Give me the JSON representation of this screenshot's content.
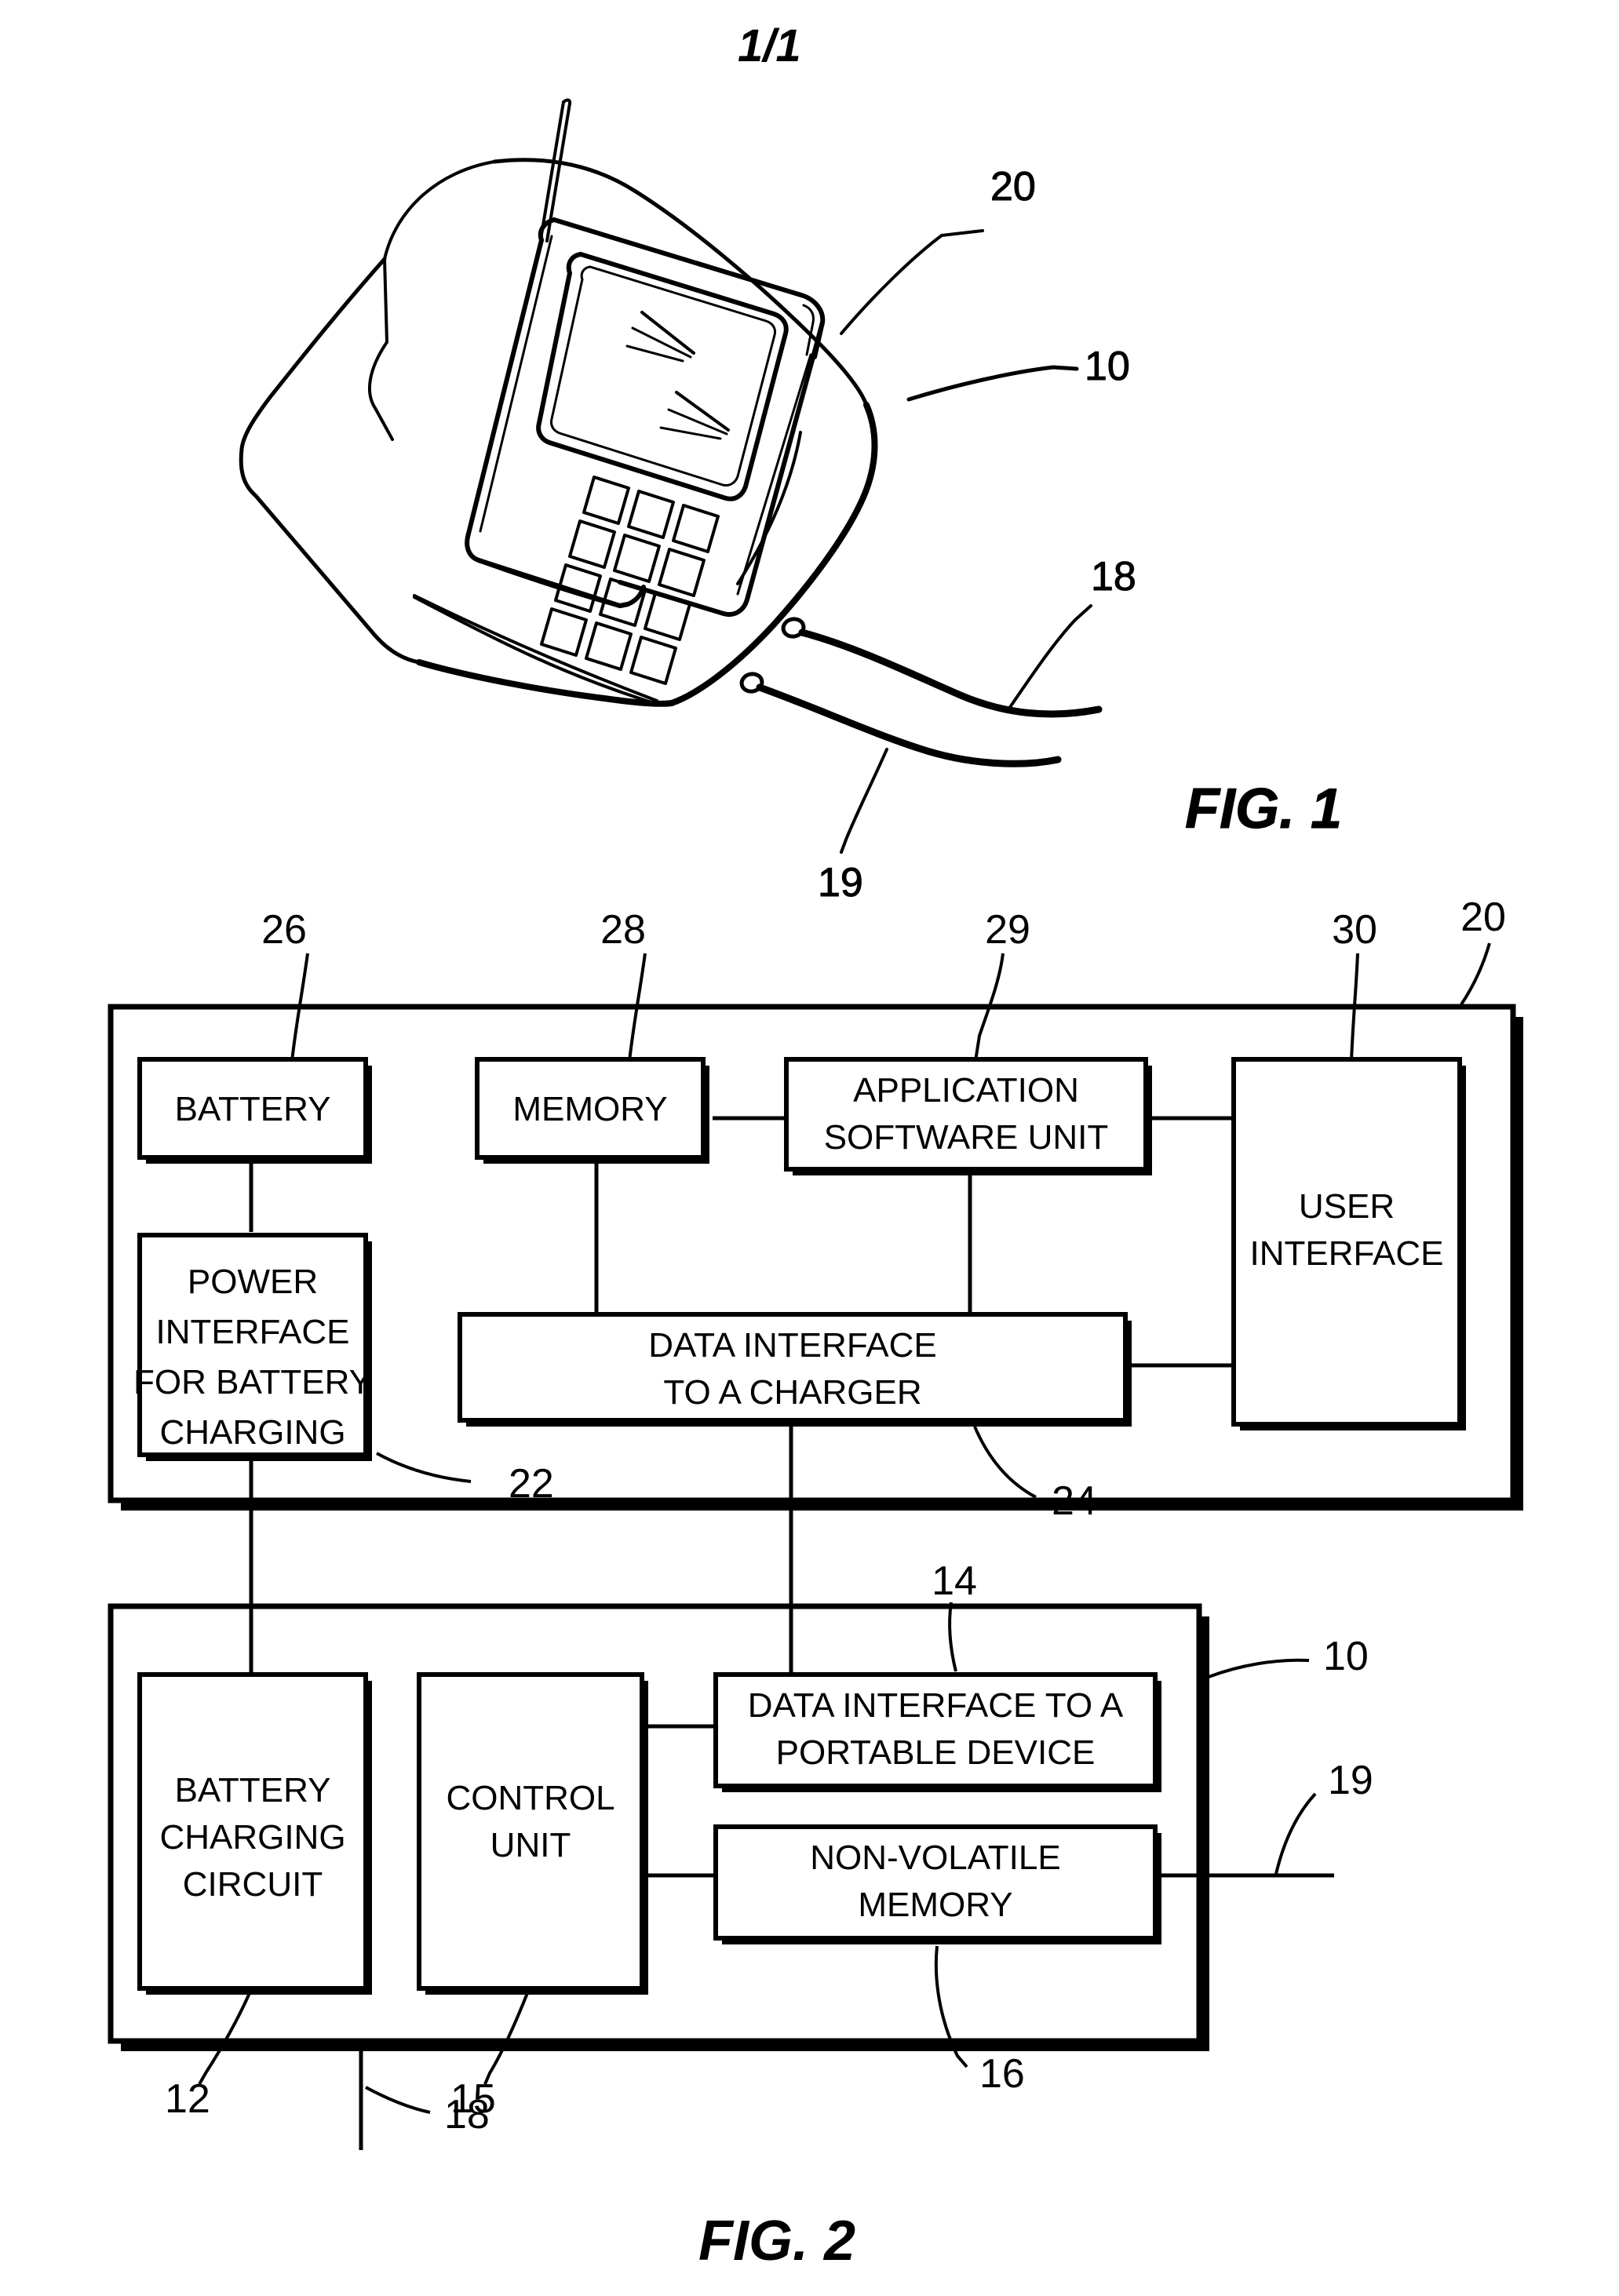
{
  "sheet": {
    "number": "1/1"
  },
  "figures": [
    {
      "id": "fig1",
      "label": "FIG. 1",
      "caption": "Perspective view of a portable device resting in a charger cradle",
      "reference_numerals": [
        {
          "num": "20",
          "refers_to": "portable device (mobile phone)"
        },
        {
          "num": "10",
          "refers_to": "charger / cradle"
        },
        {
          "num": "18",
          "refers_to": "power cable"
        },
        {
          "num": "19",
          "refers_to": "data cable"
        }
      ]
    },
    {
      "id": "fig2",
      "label": "FIG. 2",
      "caption": "Block diagram of the portable device and the charger",
      "outer_blocks": [
        {
          "num": "20",
          "name": "portable-device-enclosure"
        },
        {
          "num": "10",
          "name": "charger-enclosure"
        }
      ],
      "device_blocks": [
        {
          "num": "26",
          "label": "BATTERY"
        },
        {
          "num": "22",
          "label": "POWER\nINTERFACE\nFOR BATTERY\nCHARGING"
        },
        {
          "num": "28",
          "label": "MEMORY"
        },
        {
          "num": "29",
          "label": "APPLICATION\nSOFTWARE UNIT"
        },
        {
          "num": "24",
          "label": "DATA INTERFACE\nTO A CHARGER"
        },
        {
          "num": "30",
          "label": "USER\nINTERFACE"
        }
      ],
      "charger_blocks": [
        {
          "num": "12",
          "label": "BATTERY\nCHARGING\nCIRCUIT"
        },
        {
          "num": "15",
          "label": "CONTROL\nUNIT"
        },
        {
          "num": "14",
          "label": "DATA INTERFACE TO A\nPORTABLE DEVICE"
        },
        {
          "num": "16",
          "label": "NON-VOLATILE\nMEMORY"
        }
      ],
      "external_leads": [
        {
          "num": "18",
          "name": "mains-power-lead"
        },
        {
          "num": "19",
          "name": "external-data-lead"
        }
      ]
    }
  ],
  "block_text": {
    "battery": "BATTERY",
    "power_interface_l1": "POWER",
    "power_interface_l2": "INTERFACE",
    "power_interface_l3": "FOR BATTERY",
    "power_interface_l4": "CHARGING",
    "memory": "MEMORY",
    "app_software_l1": "APPLICATION",
    "app_software_l2": "SOFTWARE UNIT",
    "data_if_charger_l1": "DATA INTERFACE",
    "data_if_charger_l2": "TO A CHARGER",
    "user_interface_l1": "USER",
    "user_interface_l2": "INTERFACE",
    "battery_charging_l1": "BATTERY",
    "battery_charging_l2": "CHARGING",
    "battery_charging_l3": "CIRCUIT",
    "control_unit_l1": "CONTROL",
    "control_unit_l2": "UNIT",
    "data_if_device_l1": "DATA INTERFACE TO A",
    "data_if_device_l2": "PORTABLE DEVICE",
    "nvm_l1": "NON-VOLATILE",
    "nvm_l2": "MEMORY"
  },
  "numerals": {
    "n10_fig1": "10",
    "n20_fig1": "20",
    "n18_fig1": "18",
    "n19_fig1": "19",
    "n26": "26",
    "n28": "28",
    "n29": "29",
    "n30": "30",
    "n20_fig2": "20",
    "n22": "22",
    "n24": "24",
    "n14": "14",
    "n10_fig2": "10",
    "n19_fig2": "19",
    "n12": "12",
    "n18_fig2": "18",
    "n15": "15",
    "n16": "16"
  },
  "colors": {
    "ink": "#000000",
    "paper": "#ffffff"
  }
}
